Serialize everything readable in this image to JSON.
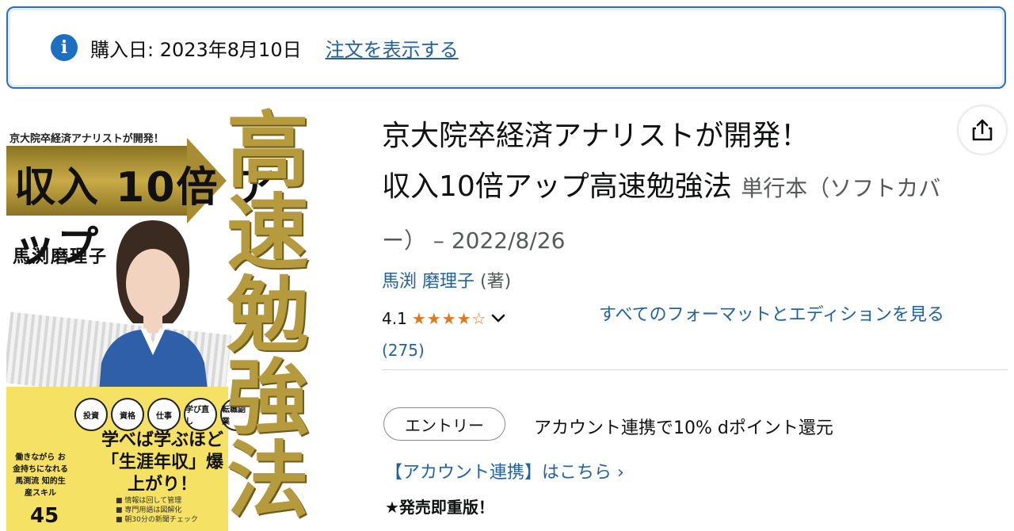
{
  "banner": {
    "icon": "info-icon",
    "purchase_text": "購入日: 2023年8月10日",
    "order_link": "注文を表示する"
  },
  "cover": {
    "top_text": "京大院卒経済アナリストが開発！",
    "arrow_text": "収入 10倍 アップ",
    "big_title": "高速勉強法",
    "author": "馬渕磨理子",
    "circles": [
      "投資",
      "資格",
      "仕事",
      "学び直し",
      "転職副業"
    ],
    "yellow_text": "学べば学ぶほど「生涯年収」爆上がり！",
    "bottom_left": "働きながら お金持ちになれる 馬渕流 知的生産スキル",
    "num": "45",
    "list": [
      "■ 情報は回して管理",
      "■ 専門用語は図解化",
      "■ 朝30分の新聞チェック"
    ]
  },
  "product": {
    "title_line1": "京大院卒経済アナリストが開発！",
    "title_line2": "収入10倍アップ高速勉強法",
    "format": "単行本（ソフトカバー）",
    "date": " – 2022/8/26",
    "author": "馬渕 磨理子",
    "author_role": " (著)",
    "rating": "4.1",
    "stars": "★★★★☆",
    "review_count": "(275)",
    "formats_link": "すべてのフォーマットとエディションを見る"
  },
  "promo": {
    "entry_button": "エントリー",
    "text": "アカウント連携で10% dポイント還元",
    "account_link": "【アカウント連携】はこちら ›",
    "reprint": "★発売即重版！"
  },
  "colors": {
    "link": "#2162a1",
    "star": "#de7921",
    "banner_border": "#2f6fb3"
  }
}
